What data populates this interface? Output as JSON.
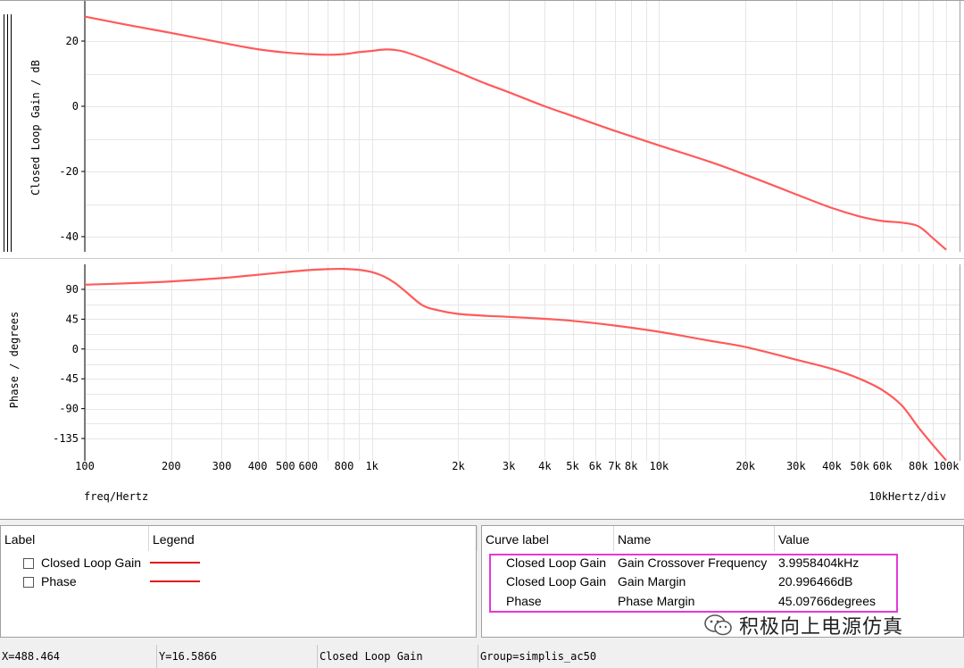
{
  "chart_data": [
    {
      "type": "line",
      "title": "",
      "xlabel": "freq/Hertz",
      "ylabel": "Closed Loop Gain / dB",
      "x_scale": "log",
      "xlim": [
        100,
        100000
      ],
      "ylim": [
        -44,
        28
      ],
      "x_tick_labels": [
        "100",
        "200",
        "300",
        "400",
        "500",
        "600",
        "800",
        "1k",
        "2k",
        "3k",
        "4k",
        "5k",
        "6k",
        "7k",
        "8k",
        "10k",
        "20k",
        "30k",
        "40k",
        "50k",
        "60k",
        "80k",
        "100k"
      ],
      "x_tick_values": [
        100,
        200,
        300,
        400,
        500,
        600,
        800,
        1000,
        2000,
        3000,
        4000,
        5000,
        6000,
        7000,
        8000,
        10000,
        20000,
        30000,
        40000,
        50000,
        60000,
        80000,
        100000
      ],
      "y_ticks": [
        20,
        0,
        -20,
        -40
      ],
      "grid": true,
      "series": [
        {
          "name": "Closed Loop Gain",
          "color": "#ff5a5a",
          "x": [
            100,
            150,
            200,
            300,
            400,
            500,
            600,
            700,
            800,
            900,
            1000,
            1100,
            1200,
            1300,
            1500,
            1700,
            2000,
            2500,
            3000,
            4000,
            5000,
            7000,
            10000,
            15000,
            20000,
            30000,
            40000,
            50000,
            60000,
            70000,
            80000,
            90000,
            100000
          ],
          "y": [
            27.5,
            24.5,
            22.5,
            19.5,
            17.5,
            16.5,
            16.0,
            15.8,
            16.0,
            16.6,
            17.0,
            17.4,
            17.3,
            16.7,
            14.8,
            12.9,
            10.4,
            6.9,
            4.3,
            0.0,
            -3.0,
            -7.5,
            -12.0,
            -17.0,
            -21.0,
            -27.0,
            -31.2,
            -33.8,
            -35.2,
            -35.7,
            -36.8,
            -40.5,
            -44.0
          ]
        }
      ]
    },
    {
      "type": "line",
      "title": "",
      "xlabel": "freq/Hertz",
      "ylabel": "Phase / degrees",
      "x_scale": "log",
      "xlim": [
        100,
        100000
      ],
      "ylim": [
        -170,
        125
      ],
      "y_ticks": [
        90,
        45,
        0,
        -45,
        -90,
        -135
      ],
      "grid": true,
      "series": [
        {
          "name": "Phase",
          "color": "#ff5a5a",
          "x": [
            100,
            150,
            200,
            300,
            400,
            500,
            600,
            700,
            800,
            900,
            1000,
            1100,
            1200,
            1300,
            1500,
            1700,
            2000,
            2500,
            3000,
            4000,
            5000,
            7000,
            10000,
            15000,
            20000,
            30000,
            40000,
            50000,
            60000,
            70000,
            80000,
            90000,
            100000
          ],
          "y": [
            97.0,
            99.5,
            102.0,
            107.0,
            112.0,
            116.0,
            119.0,
            120.5,
            120.8,
            119.5,
            116.0,
            109.5,
            100.0,
            88.0,
            66.0,
            58.5,
            53.0,
            50.0,
            48.5,
            45.5,
            42.5,
            35.5,
            26.0,
            12.5,
            3.0,
            -16.0,
            -30.0,
            -45.0,
            -62.0,
            -85.0,
            -118.0,
            -145.0,
            -168.0
          ]
        }
      ]
    }
  ],
  "axis": {
    "gain_ylabel": "Closed Loop Gain / dB",
    "phase_ylabel": "Phase / degrees",
    "xlabel": "freq/Hertz",
    "xdiv_label": "10kHertz/div"
  },
  "legend_panel": {
    "col_label": "Label",
    "col_legend": "Legend",
    "rows": [
      {
        "label": "Closed Loop Gain",
        "line_color": "#e0161a"
      },
      {
        "label": "Phase",
        "line_color": "#e0161a"
      }
    ]
  },
  "measure_panel": {
    "col_curve": "Curve label",
    "col_name": "Name",
    "col_value": "Value",
    "rows": [
      {
        "curve": "Closed Loop Gain",
        "name": "Gain Crossover Frequency",
        "value": "3.9958404kHz"
      },
      {
        "curve": "Closed Loop Gain",
        "name": "Gain Margin",
        "value": "20.996466dB"
      },
      {
        "curve": "Phase",
        "name": "Phase Margin",
        "value": "45.09766degrees"
      }
    ]
  },
  "status_bar": {
    "x": "X=488.464",
    "y": "Y=16.5866",
    "curve": "Closed Loop Gain",
    "group": "Group=simplis_ac50"
  },
  "watermark": {
    "text": "积极向上电源仿真",
    "icon": "wechat-icon"
  }
}
